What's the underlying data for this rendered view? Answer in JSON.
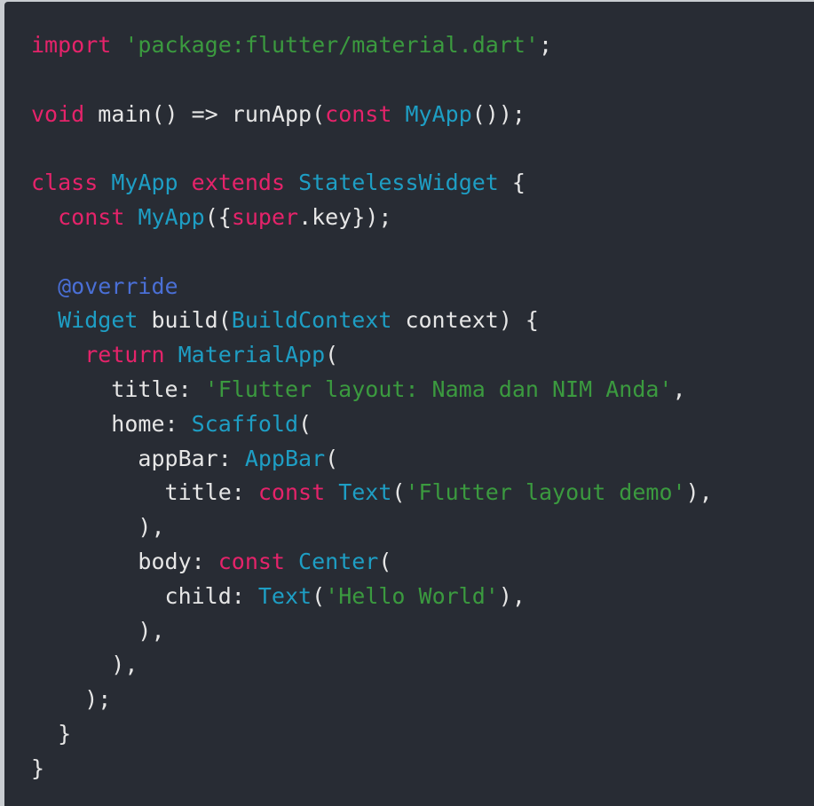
{
  "editor": {
    "lines": [
      [
        {
          "t": "import",
          "k": "kw"
        },
        {
          "t": " ",
          "k": "plain"
        },
        {
          "t": "'package:flutter/material.dart'",
          "k": "str"
        },
        {
          "t": ";",
          "k": "plain"
        }
      ],
      [],
      [
        {
          "t": "void",
          "k": "kw"
        },
        {
          "t": " main() => runApp(",
          "k": "plain"
        },
        {
          "t": "const",
          "k": "kw"
        },
        {
          "t": " ",
          "k": "plain"
        },
        {
          "t": "MyApp",
          "k": "type"
        },
        {
          "t": "());",
          "k": "plain"
        }
      ],
      [],
      [
        {
          "t": "class",
          "k": "kw"
        },
        {
          "t": " ",
          "k": "plain"
        },
        {
          "t": "MyApp",
          "k": "type"
        },
        {
          "t": " ",
          "k": "plain"
        },
        {
          "t": "extends",
          "k": "kw"
        },
        {
          "t": " ",
          "k": "plain"
        },
        {
          "t": "StatelessWidget",
          "k": "type"
        },
        {
          "t": " {",
          "k": "plain"
        }
      ],
      [
        {
          "t": "  ",
          "k": "plain"
        },
        {
          "t": "const",
          "k": "kw"
        },
        {
          "t": " ",
          "k": "plain"
        },
        {
          "t": "MyApp",
          "k": "type"
        },
        {
          "t": "({",
          "k": "plain"
        },
        {
          "t": "super",
          "k": "kw"
        },
        {
          "t": ".key});",
          "k": "plain"
        }
      ],
      [],
      [
        {
          "t": "  ",
          "k": "plain"
        },
        {
          "t": "@override",
          "k": "ann"
        }
      ],
      [
        {
          "t": "  ",
          "k": "plain"
        },
        {
          "t": "Widget",
          "k": "type"
        },
        {
          "t": " build(",
          "k": "plain"
        },
        {
          "t": "BuildContext",
          "k": "type"
        },
        {
          "t": " context) {",
          "k": "plain"
        }
      ],
      [
        {
          "t": "    ",
          "k": "plain"
        },
        {
          "t": "return",
          "k": "kw"
        },
        {
          "t": " ",
          "k": "plain"
        },
        {
          "t": "MaterialApp",
          "k": "type"
        },
        {
          "t": "(",
          "k": "plain"
        }
      ],
      [
        {
          "t": "      title: ",
          "k": "plain"
        },
        {
          "t": "'Flutter layout: Nama dan NIM Anda'",
          "k": "str"
        },
        {
          "t": ",",
          "k": "plain"
        }
      ],
      [
        {
          "t": "      home: ",
          "k": "plain"
        },
        {
          "t": "Scaffold",
          "k": "type"
        },
        {
          "t": "(",
          "k": "plain"
        }
      ],
      [
        {
          "t": "        appBar: ",
          "k": "plain"
        },
        {
          "t": "AppBar",
          "k": "type"
        },
        {
          "t": "(",
          "k": "plain"
        }
      ],
      [
        {
          "t": "          title: ",
          "k": "plain"
        },
        {
          "t": "const",
          "k": "kw"
        },
        {
          "t": " ",
          "k": "plain"
        },
        {
          "t": "Text",
          "k": "type"
        },
        {
          "t": "(",
          "k": "plain"
        },
        {
          "t": "'Flutter layout demo'",
          "k": "str"
        },
        {
          "t": "),",
          "k": "plain"
        }
      ],
      [
        {
          "t": "        ),",
          "k": "plain"
        }
      ],
      [
        {
          "t": "        body: ",
          "k": "plain"
        },
        {
          "t": "const",
          "k": "kw"
        },
        {
          "t": " ",
          "k": "plain"
        },
        {
          "t": "Center",
          "k": "type"
        },
        {
          "t": "(",
          "k": "plain"
        }
      ],
      [
        {
          "t": "          child: ",
          "k": "plain"
        },
        {
          "t": "Text",
          "k": "type"
        },
        {
          "t": "(",
          "k": "plain"
        },
        {
          "t": "'Hello World'",
          "k": "str"
        },
        {
          "t": "),",
          "k": "plain"
        }
      ],
      [
        {
          "t": "        ),",
          "k": "plain"
        }
      ],
      [
        {
          "t": "      ),",
          "k": "plain"
        }
      ],
      [
        {
          "t": "    );",
          "k": "plain"
        }
      ],
      [
        {
          "t": "  }",
          "k": "plain"
        }
      ],
      [
        {
          "t": "}",
          "k": "plain"
        }
      ]
    ]
  }
}
